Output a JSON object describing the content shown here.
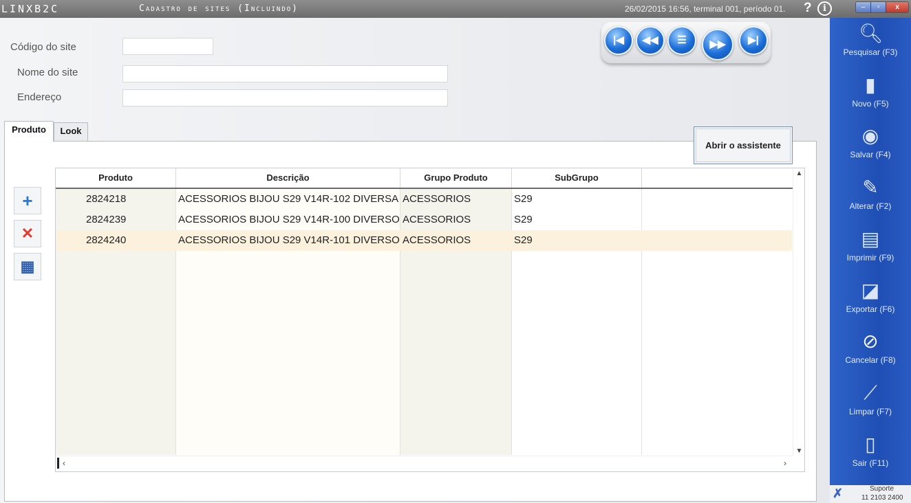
{
  "titlebar": {
    "app_name": "LINXB2C",
    "window_title": "Cadastro de sites (Incluindo)",
    "status": "26/02/2015 16:56, terminal 001, período 01.",
    "help": "?",
    "info": "i",
    "min": "–",
    "max": "▫",
    "close": "x"
  },
  "form": {
    "codigo_label": "Código do site",
    "codigo_value": "",
    "nome_label": "Nome do site",
    "nome_value": "",
    "endereco_label": "Endereço",
    "endereco_value": ""
  },
  "nav": {
    "first": "|◀",
    "prev": "◀◀",
    "menu": "☰",
    "next": "▶▶",
    "last": "▶|"
  },
  "tabs": [
    {
      "label": "Produto",
      "active": true
    },
    {
      "label": "Look",
      "active": false
    }
  ],
  "wizard_button": "Abrir o assistente",
  "side_buttons": {
    "add": "+",
    "remove": "✕",
    "film": "▦"
  },
  "grid": {
    "columns": [
      "Produto",
      "Descrição",
      "Grupo Produto",
      "SubGrupo",
      ""
    ],
    "rows": [
      [
        "2824218",
        "ACESSORIOS BIJOU S29 V14R-102 DIVERSA",
        "ACESSORIOS",
        "S29",
        ""
      ],
      [
        "2824239",
        "ACESSORIOS BIJOU S29 V14R-100 DIVERSO",
        "ACESSORIOS",
        "S29",
        ""
      ],
      [
        "2824240",
        "ACESSORIOS BIJOU S29 V14R-101 DIVERSO",
        "ACESSORIOS",
        "S29",
        ""
      ]
    ],
    "selected_row": 2
  },
  "toolbar": {
    "pesquisar": "Pesquisar (F3)",
    "novo": "Novo (F5)",
    "salvar": "Salvar (F4)",
    "alterar": "Alterar (F2)",
    "imprimir": "Imprimir (F9)",
    "exportar": "Exportar (F6)",
    "cancelar": "Cancelar (F8)",
    "limpar": "Limpar (F7)",
    "sair": "Sair (F11)"
  },
  "support": {
    "label": "Suporte",
    "phone": "11 2103 2400"
  }
}
